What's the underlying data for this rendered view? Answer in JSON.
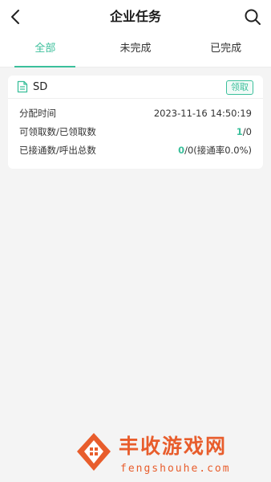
{
  "header": {
    "title": "企业任务"
  },
  "tabs": [
    {
      "label": "全部",
      "active": true
    },
    {
      "label": "未完成",
      "active": false
    },
    {
      "label": "已完成",
      "active": false
    }
  ],
  "task": {
    "name": "SD",
    "claim_label": "领取",
    "rows": {
      "assign_time": {
        "label": "分配时间",
        "value": "2023-11-16 14:50:19"
      },
      "claim": {
        "label": "可领取数/已领取数",
        "highlight": "1",
        "rest": "/0"
      },
      "connect": {
        "label": "已接通数/呼出总数",
        "highlight": "0",
        "rest": "/0(接通率0.0%)"
      }
    }
  },
  "watermark": {
    "brand": "丰收游戏网",
    "domain": "fengshouhe.com"
  },
  "colors": {
    "accent": "#3bbf9b",
    "watermark": "#e85d2c"
  }
}
